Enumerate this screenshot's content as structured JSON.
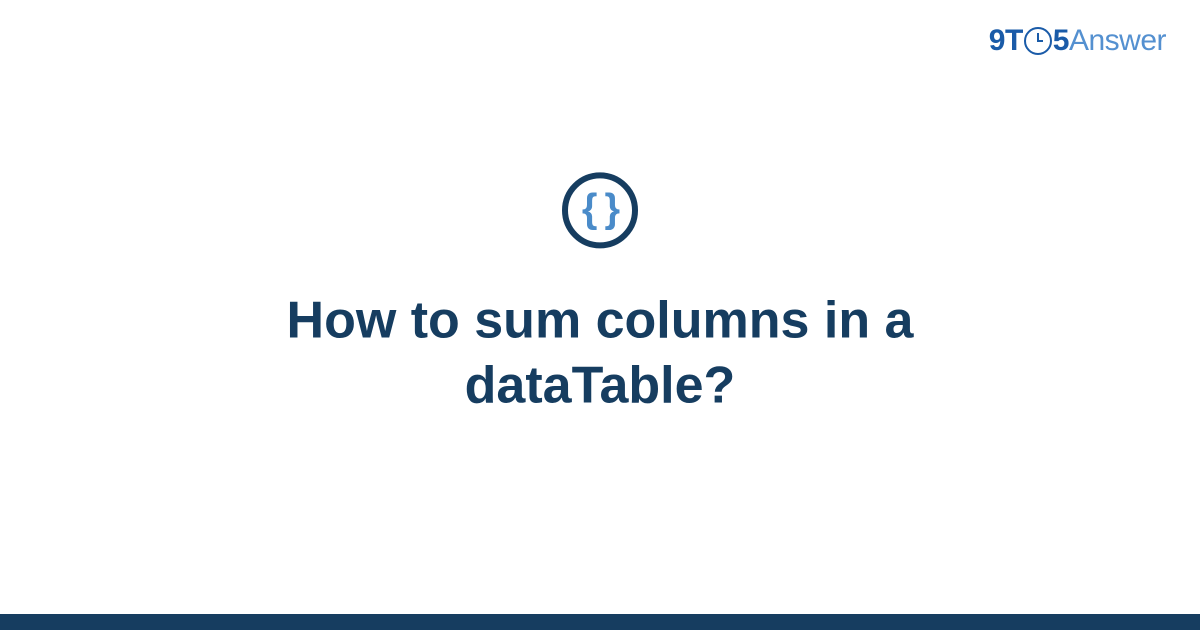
{
  "logo": {
    "prefix_9": "9",
    "prefix_T": "T",
    "prefix_5": "5",
    "suffix": "Answer"
  },
  "badge": {
    "icon_glyph": "{ }",
    "icon_name": "code-braces"
  },
  "title": "How to sum columns in a dataTable?",
  "colors": {
    "brand_dark": "#163d60",
    "brand_medium": "#1a5ba8",
    "brand_light": "#5490d0"
  }
}
